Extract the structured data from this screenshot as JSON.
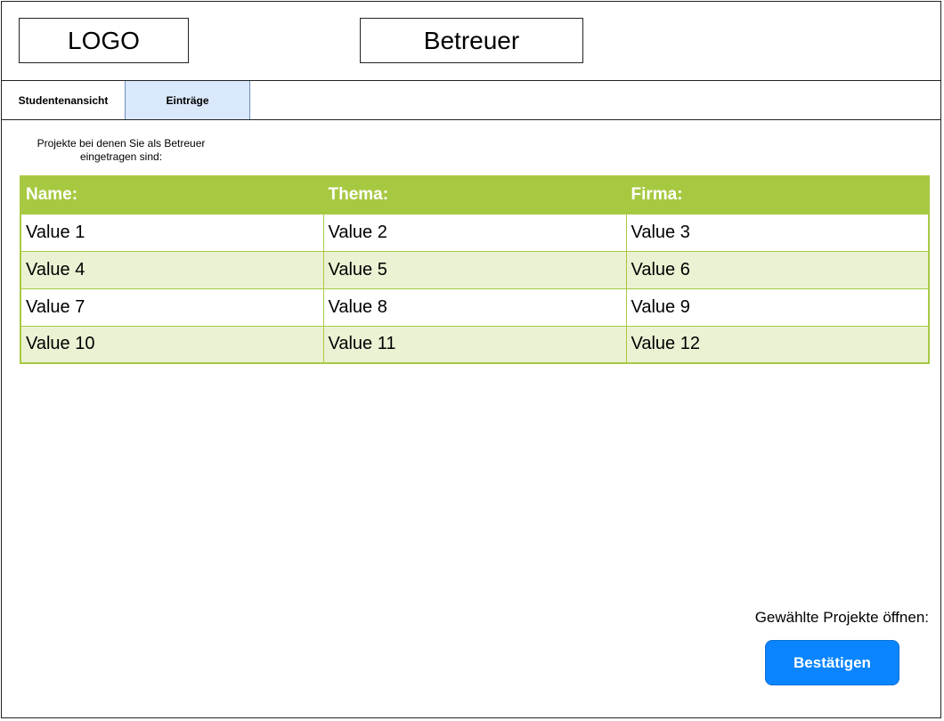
{
  "header": {
    "logo": "LOGO",
    "title": "Betreuer"
  },
  "tabs": [
    {
      "label": "Studentenansicht",
      "active": false
    },
    {
      "label": "Einträge",
      "active": true
    }
  ],
  "intro_text": "Projekte bei denen Sie als Betreuer eingetragen sind:",
  "table": {
    "columns": [
      "Name:",
      "Thema:",
      "Firma:"
    ],
    "rows": [
      [
        "Value 1",
        "Value 2",
        "Value 3"
      ],
      [
        "Value 4",
        "Value 5",
        "Value 6"
      ],
      [
        "Value 7",
        "Value 8",
        "Value 9"
      ],
      [
        "Value 10",
        "Value 11",
        "Value 12"
      ]
    ],
    "header_color": "#a7c942",
    "alt_row_color": "#eaf2d3"
  },
  "footer": {
    "open_label": "Gewählte Projekte öffnen:",
    "confirm_label": "Bestätigen",
    "confirm_color": "#0a85ff"
  }
}
